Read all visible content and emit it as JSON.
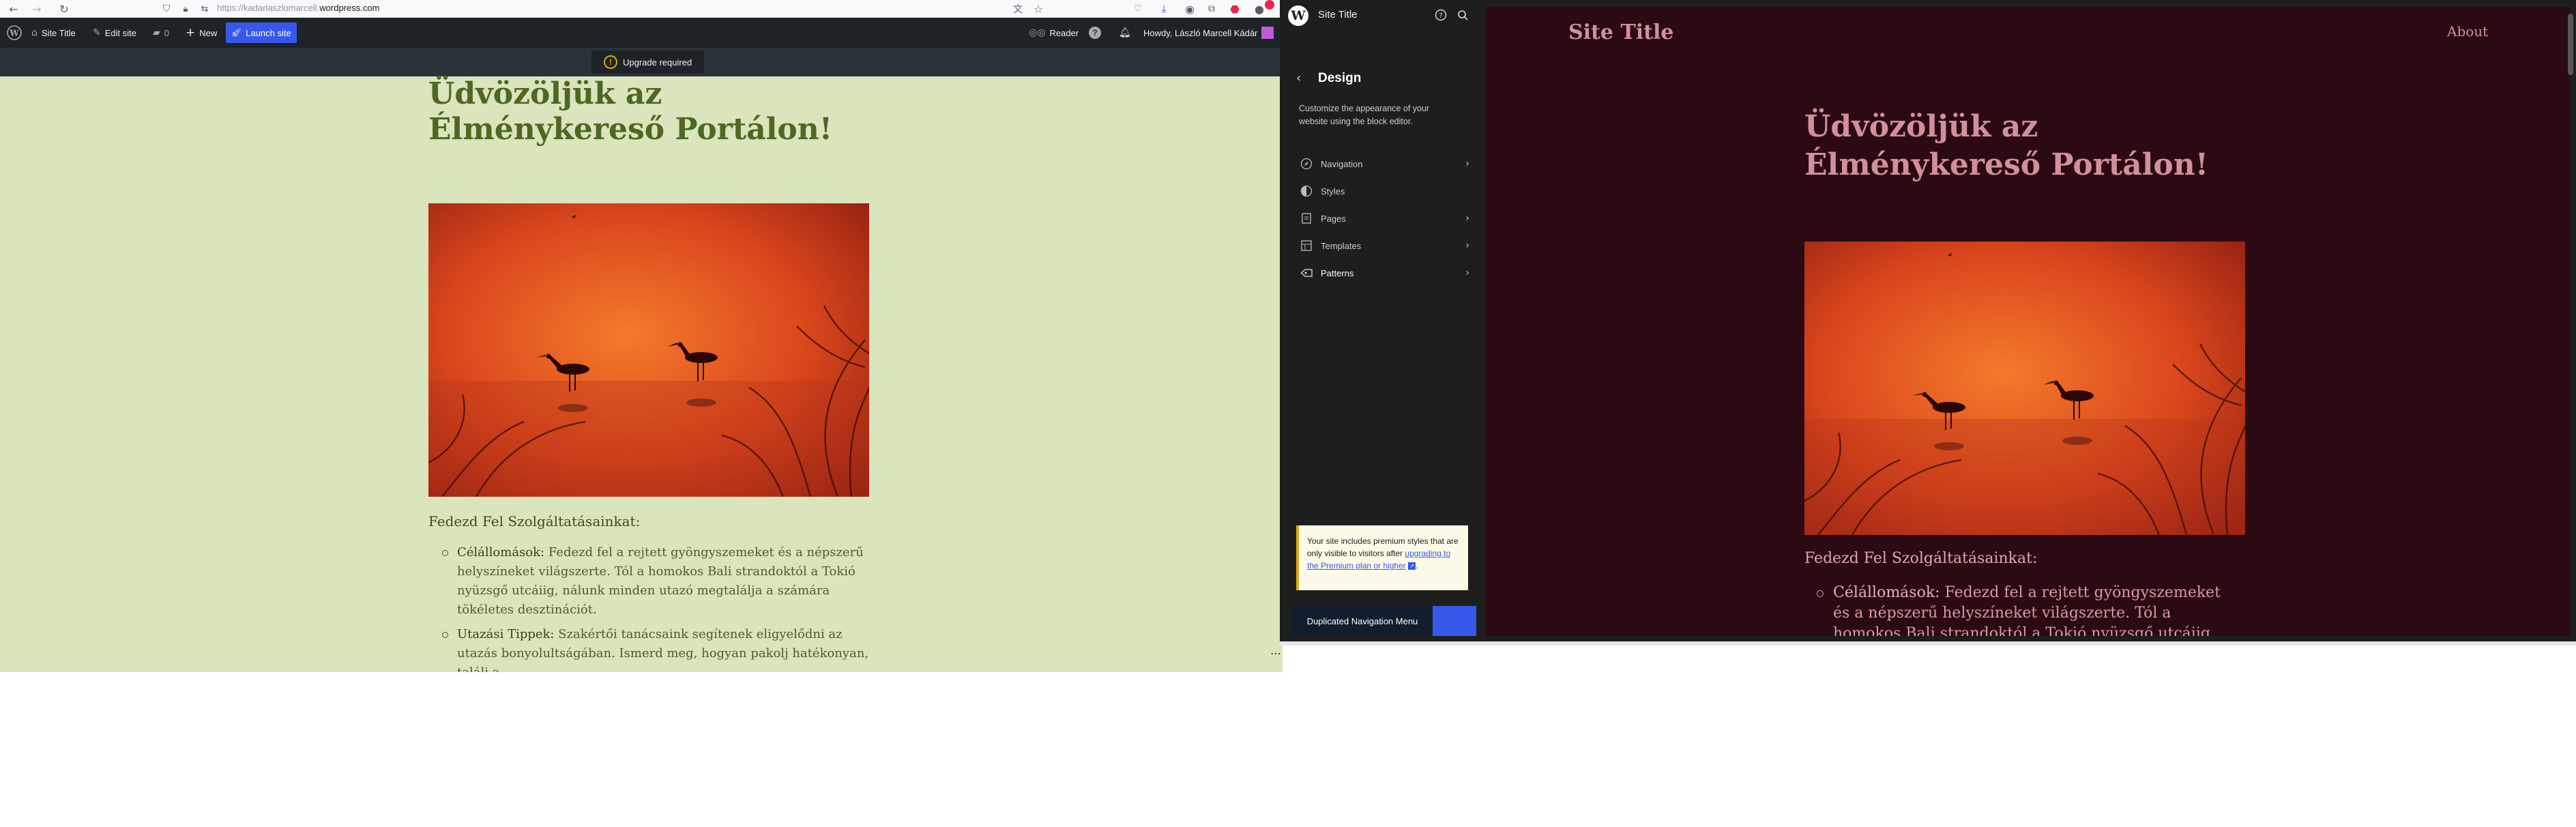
{
  "browser": {
    "url_prefix": "https://kadarlaszlomarcell.",
    "url_domain": "wordpress.com"
  },
  "adminbar": {
    "site_title": "Site Title",
    "edit_site": "Edit site",
    "comments_count": "0",
    "new_label": "New",
    "launch_label": "Launch site",
    "reader": "Reader",
    "howdy": "Howdy, László Marcell Kádár"
  },
  "upgrade": {
    "label": "Upgrade required"
  },
  "frontend": {
    "title": "Üdvözöljük az Élménykereső Portálon!",
    "subhead": "Fedezd Fel Szolgáltatásainkat:",
    "items": [
      {
        "lead": "Célállomások:",
        "text": " Fedezd fel a rejtett gyöngyszemeket és a népszerű helyszíneket világszerte. Tól a homokos Bali strandoktól a Tokió nyüzsgő utcáiig, nálunk minden utazó megtalálja a számára tökéletes desztinációt."
      },
      {
        "lead": "Utazási Tippek:",
        "text": " Szakértői tanácsaink segítenek eligyelődni az utazás bonyolultságában. Ismerd meg, hogyan pakolj hatékonyan, találj a"
      }
    ]
  },
  "sidebar": {
    "site_title": "Site Title",
    "heading": "Design",
    "description": "Customize the appearance of your website using the block editor.",
    "items": [
      {
        "label": "Navigation",
        "icon": "navigation-icon",
        "chevron": true
      },
      {
        "label": "Styles",
        "icon": "styles-icon",
        "chevron": false
      },
      {
        "label": "Pages",
        "icon": "pages-icon",
        "chevron": true
      },
      {
        "label": "Templates",
        "icon": "templates-icon",
        "chevron": true
      },
      {
        "label": "Patterns",
        "icon": "patterns-icon",
        "chevron": true
      }
    ],
    "notice_text": "Your site includes premium styles that are only visible to visitors after",
    "notice_link": "upgrading to the Premium plan or higher",
    "notice_end": ".",
    "dup_button": "Duplicated Navigation Menu"
  },
  "canvas": {
    "site_title": "Site Title",
    "about": "About",
    "title": "Üdvözöljük az Élménykereső Portálon!",
    "subhead": "Fedezd Fel Szolgáltatásainkat:",
    "item_lead": "Célállomások:",
    "item_text": " Fedezd fel a rejtett gyöngyszemeket és a népszerű helyszíneket világszerte. Tól a homokos Bali strandoktól a Tokió nyüzsgő utcáiig, nálunk minden utazó"
  },
  "colors": {
    "frontend_bg": "#dae4bd",
    "frontend_heading": "#4d6821",
    "canvas_bg": "#2c0a14",
    "canvas_text": "#d2909a",
    "wp_blue": "#3858e9",
    "notice_border": "#dba617"
  }
}
